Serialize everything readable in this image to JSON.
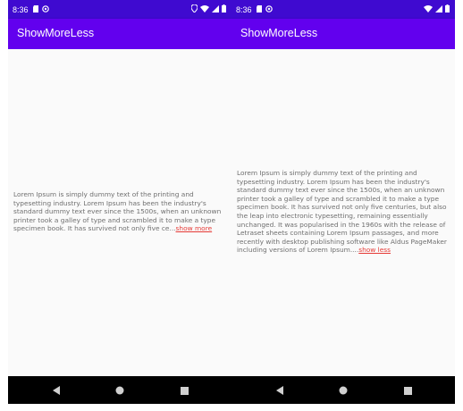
{
  "status_bar": {
    "time": "8:36",
    "color": "#3f0ad0",
    "left_icons": [
      "sd-card-icon",
      "at-sign-icon"
    ],
    "right_icons_left_screen": [
      "location-icon",
      "wifi-icon",
      "signal-icon",
      "battery-icon"
    ],
    "right_icons_right_screen": [
      "wifi-icon",
      "signal-icon",
      "battery-icon"
    ]
  },
  "app_bar": {
    "title": "ShowMoreLess",
    "color": "#6200ee"
  },
  "screens": {
    "collapsed": {
      "text": "Lorem Ipsum is simply dummy text of the printing and typesetting industry. Lorem Ipsum has been the industry's standard dummy text ever since the 1500s, when an unknown printer took a galley of type and scrambled it to make a type specimen book. It has survived not only five ce...",
      "toggle_label": "show more"
    },
    "expanded": {
      "text": "Lorem Ipsum is simply dummy text of the printing and typesetting industry. Lorem Ipsum has been the industry's standard dummy text ever since the 1500s, when an unknown printer took a galley of type and scrambled it to make a type specimen book. It has survived not only five centuries, but also the leap into electronic typesetting, remaining essentially unchanged. It was popularised in the 1960s with the release of Letraset sheets containing Lorem Ipsum passages, and more recently with desktop publishing software like Aldus PageMaker including versions of Lorem Ipsum....",
      "toggle_label": "show less"
    }
  },
  "link_color": "#e53935",
  "nav_bar": {
    "buttons": [
      "back-icon",
      "home-icon",
      "recents-icon"
    ]
  }
}
